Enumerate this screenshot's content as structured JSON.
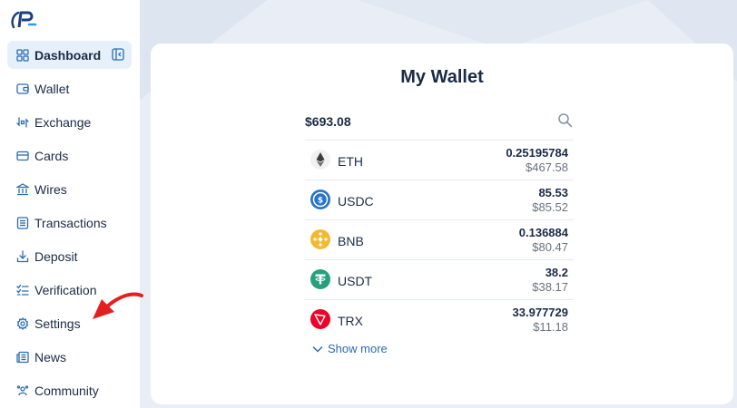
{
  "sidebar": {
    "items": [
      {
        "label": "Dashboard",
        "icon": "grid-icon",
        "active": true
      },
      {
        "label": "Wallet",
        "icon": "wallet-icon"
      },
      {
        "label": "Exchange",
        "icon": "exchange-icon"
      },
      {
        "label": "Cards",
        "icon": "card-icon"
      },
      {
        "label": "Wires",
        "icon": "bank-icon"
      },
      {
        "label": "Transactions",
        "icon": "list-icon"
      },
      {
        "label": "Deposit",
        "icon": "download-icon"
      },
      {
        "label": "Verification",
        "icon": "checklist-icon"
      },
      {
        "label": "Settings",
        "icon": "gear-icon"
      },
      {
        "label": "News",
        "icon": "news-icon"
      },
      {
        "label": "Community",
        "icon": "community-icon"
      }
    ]
  },
  "wallet": {
    "title": "My Wallet",
    "total": "$693.08",
    "assets": [
      {
        "symbol": "ETH",
        "amount": "0.25195784",
        "usd": "$467.58",
        "color": "#3c3c3d"
      },
      {
        "symbol": "USDC",
        "amount": "85.53",
        "usd": "$85.52",
        "color": "#2775ca"
      },
      {
        "symbol": "BNB",
        "amount": "0.136884",
        "usd": "$80.47",
        "color": "#f3ba2f"
      },
      {
        "symbol": "USDT",
        "amount": "38.2",
        "usd": "$38.17",
        "color": "#26a17b"
      },
      {
        "symbol": "TRX",
        "amount": "33.977729",
        "usd": "$11.18",
        "color": "#ef0027"
      }
    ],
    "show_more": "Show more"
  },
  "colors": {
    "accent": "#2b6cb0",
    "annotation": "#e32020"
  }
}
